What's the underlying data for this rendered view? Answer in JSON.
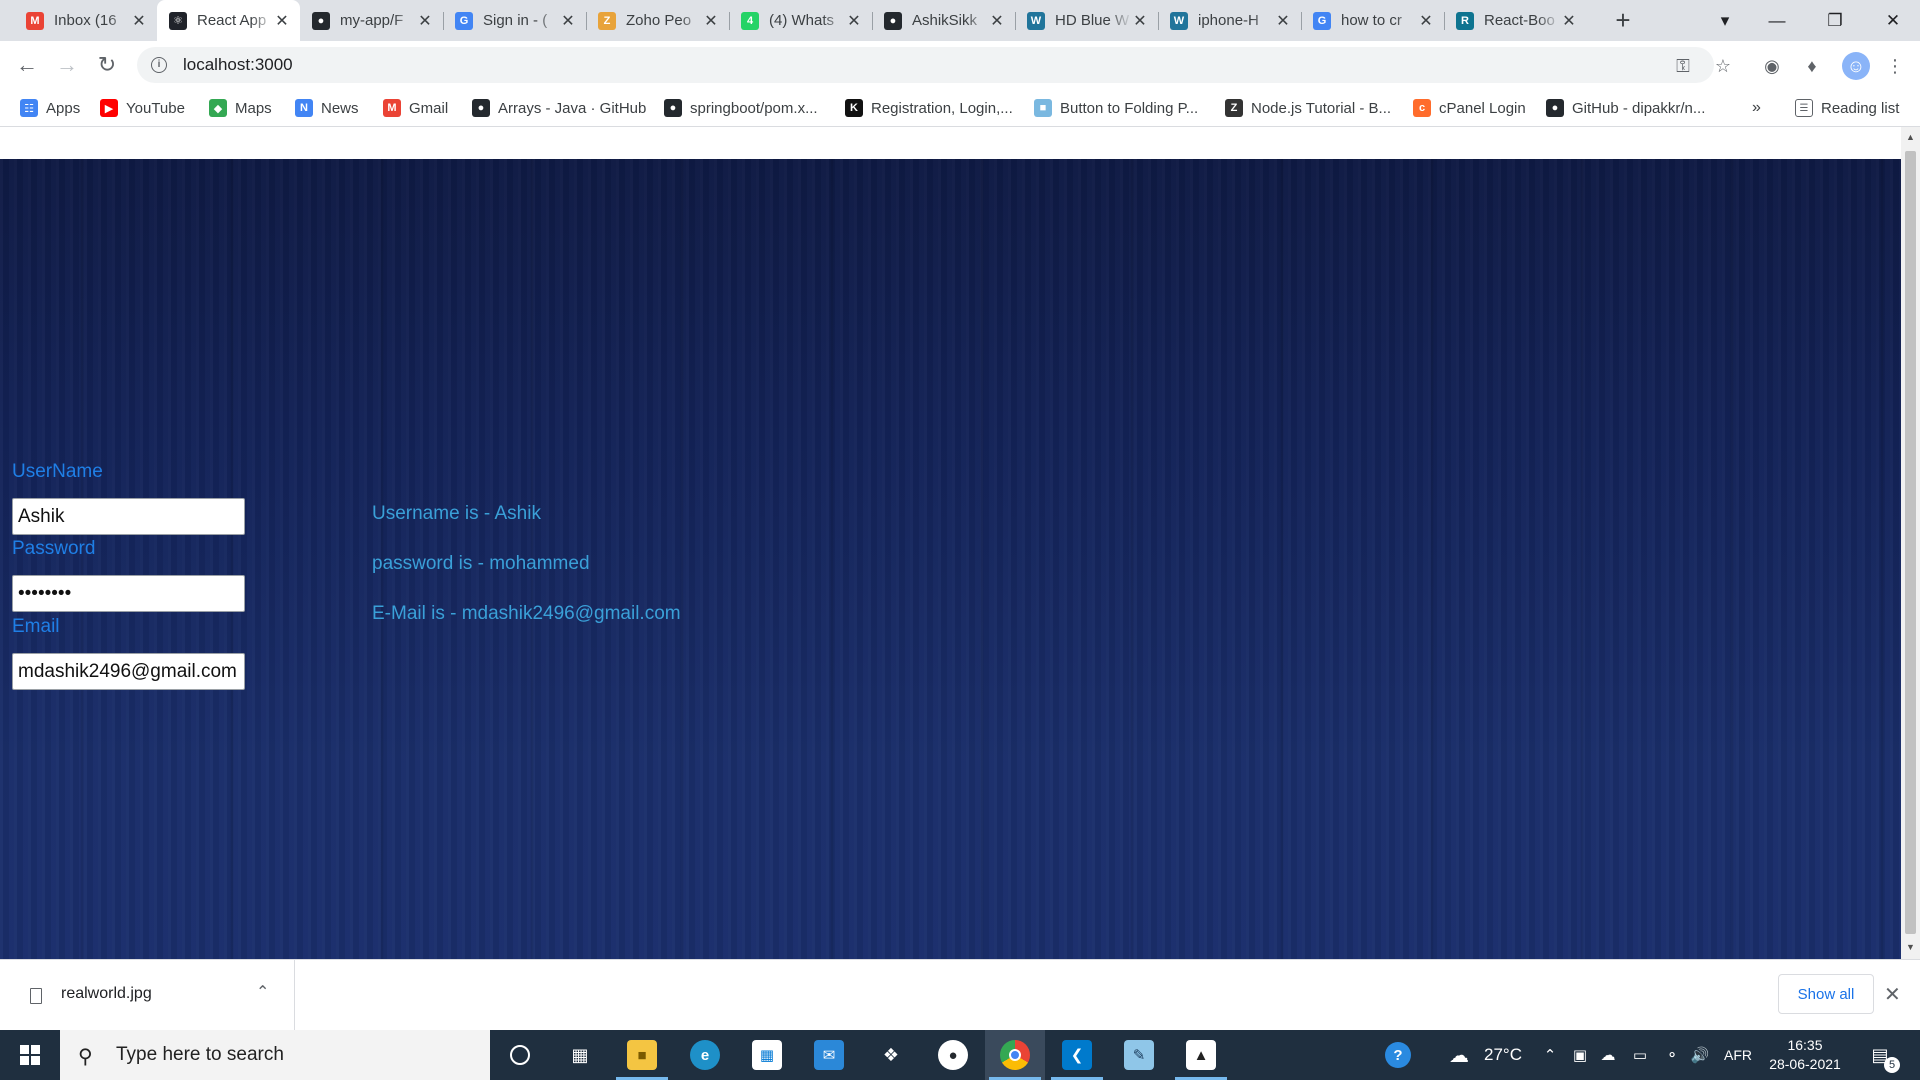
{
  "browser": {
    "tabs": [
      {
        "title": "Inbox (16",
        "icon": "gmail-icon",
        "color": "#ea4335",
        "glyph": "M",
        "active": false
      },
      {
        "title": "React App",
        "icon": "react-icon",
        "color": "#20232a",
        "glyph": "⚛",
        "active": true
      },
      {
        "title": "my-app/F",
        "icon": "github-icon",
        "color": "#24292e",
        "glyph": "●",
        "active": false
      },
      {
        "title": "Sign in - (",
        "icon": "google-icon",
        "color": "#4285f4",
        "glyph": "G",
        "active": false
      },
      {
        "title": "Zoho Peo",
        "icon": "zoho-icon",
        "color": "#e8a33a",
        "glyph": "Z",
        "active": false
      },
      {
        "title": "(4) Whats",
        "icon": "whatsapp-icon",
        "color": "#25d366",
        "glyph": "4",
        "active": false
      },
      {
        "title": "AshikSikk",
        "icon": "github-icon",
        "color": "#24292e",
        "glyph": "●",
        "active": false
      },
      {
        "title": "HD Blue W",
        "icon": "wordpress-icon",
        "color": "#21759b",
        "glyph": "W",
        "active": false
      },
      {
        "title": "iphone-H",
        "icon": "wordpress-icon",
        "color": "#21759b",
        "glyph": "W",
        "active": false
      },
      {
        "title": "how to cr",
        "icon": "google-icon",
        "color": "#4285f4",
        "glyph": "G",
        "active": false
      },
      {
        "title": "React-Boo",
        "icon": "react-boot-icon",
        "color": "#0e7490",
        "glyph": "R",
        "active": false
      }
    ],
    "url": "localhost:3000",
    "bookmarks": [
      {
        "label": "Apps",
        "icon": "apps-grid-icon",
        "color": "#4285f4",
        "glyph": "☷"
      },
      {
        "label": "YouTube",
        "icon": "youtube-icon",
        "color": "#ff0000",
        "glyph": "▶"
      },
      {
        "label": "Maps",
        "icon": "maps-icon",
        "color": "#34a853",
        "glyph": "◆"
      },
      {
        "label": "News",
        "icon": "google-news-icon",
        "color": "#4285f4",
        "glyph": "N"
      },
      {
        "label": "Gmail",
        "icon": "gmail-icon",
        "color": "#ea4335",
        "glyph": "M"
      },
      {
        "label": "Arrays - Java · GitHub",
        "icon": "github-icon",
        "color": "#24292e",
        "glyph": "●"
      },
      {
        "label": "springboot/pom.x...",
        "icon": "github-icon",
        "color": "#24292e",
        "glyph": "●"
      },
      {
        "label": "Registration, Login,...",
        "icon": "k-site-icon",
        "color": "#111111",
        "glyph": "K"
      },
      {
        "label": "Button to Folding P...",
        "icon": "image-site-icon",
        "color": "#7ab8e0",
        "glyph": "■"
      },
      {
        "label": "Node.js Tutorial - B...",
        "icon": "z-site-icon",
        "color": "#333333",
        "glyph": "Z"
      },
      {
        "label": "cPanel Login",
        "icon": "cpanel-icon",
        "color": "#ff6c2c",
        "glyph": "c"
      },
      {
        "label": "GitHub - dipakkr/n...",
        "icon": "github-icon",
        "color": "#24292e",
        "glyph": "●"
      }
    ],
    "more_bookmarks": "»",
    "reading_list": "Reading list"
  },
  "page": {
    "username_label": "UserName",
    "username_value": "Ashik",
    "password_label": "Password",
    "password_value": "mohammed",
    "email_label": "Email",
    "email_value": "mdashik2496@gmail.com",
    "out_username": "Username is - Ashik",
    "out_password": "password is - mohammed",
    "out_email": "E-Mail is - mdashik2496@gmail.com"
  },
  "download": {
    "filename": "realworld.jpg",
    "show_all": "Show all"
  },
  "taskbar": {
    "search_placeholder": "Type here to search",
    "temperature": "27°C",
    "language": "AFR",
    "time": "16:35",
    "date": "28-06-2021",
    "notifications": "5"
  }
}
